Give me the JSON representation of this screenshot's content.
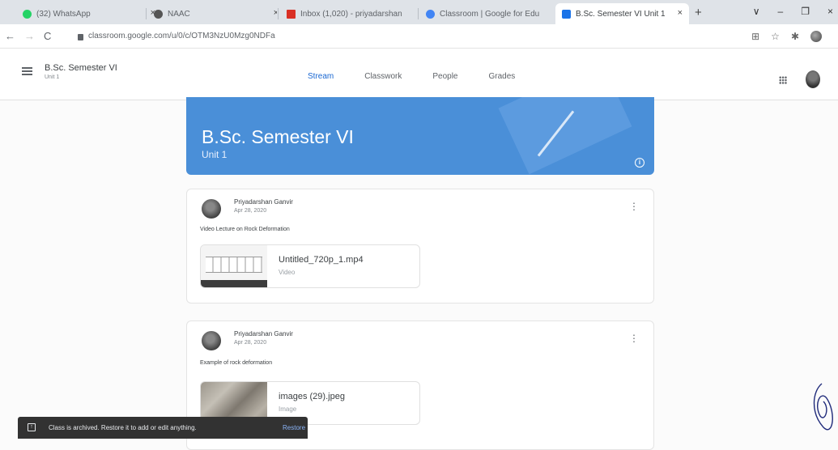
{
  "browser": {
    "tabs": [
      {
        "title": "(32) WhatsApp",
        "favicon_color": "#25d366",
        "close": "×"
      },
      {
        "title": "NAAC",
        "favicon_color": "#555555",
        "close": "×"
      },
      {
        "title": "Inbox (1,020) - priyadarshan",
        "favicon_color": "#d93025",
        "close": "×"
      },
      {
        "title": "Classroom | Google for Edu",
        "favicon_color": "#4285f4",
        "close": "×"
      },
      {
        "title": "B.Sc. Semester VI Unit 1",
        "favicon_color": "#1a73e8",
        "close": "×",
        "active": true
      }
    ],
    "new_tab": "+",
    "window_controls": {
      "dropdown": "∨",
      "minimize": "–",
      "restore": "❐",
      "close": "×"
    },
    "nav": {
      "back": "←",
      "forward": "→",
      "reload": "C"
    },
    "url": "classroom.google.com/u/0/c/OTM3NzU0Mzg0NDFa",
    "right_icons": {
      "ext": "⊞",
      "star": "☆",
      "puzzle": "✱"
    }
  },
  "app": {
    "course_title": "B.Sc. Semester VI",
    "course_subtitle": "Unit 1",
    "tabs": [
      {
        "label": "Stream",
        "active": true
      },
      {
        "label": "Classwork"
      },
      {
        "label": "People"
      },
      {
        "label": "Grades"
      }
    ]
  },
  "banner": {
    "title": "B.Sc. Semester VI",
    "subtitle": "Unit 1",
    "info_icon": "i",
    "color": "#4a8fd8"
  },
  "posts": [
    {
      "author": "Priyadarshan Ganvir",
      "date": "Apr 28, 2020",
      "text": "Video Lecture on Rock Deformation",
      "attachment": {
        "name": "Untitled_720p_1.mp4",
        "type": "Video"
      }
    },
    {
      "author": "Priyadarshan Ganvir",
      "date": "Apr 28, 2020",
      "text": "Example of rock deformation",
      "attachment": {
        "name": "images (29).jpeg",
        "type": "Image"
      }
    }
  ],
  "snackbar": {
    "message": "Class is archived. Restore it to add or edit anything.",
    "action": "Restore",
    "icon": "↑"
  },
  "menu_glyph": "⋮"
}
